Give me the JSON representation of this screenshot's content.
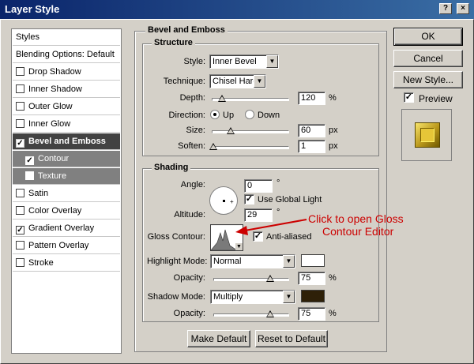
{
  "window": {
    "title": "Layer Style",
    "help_glyph": "?",
    "close_glyph": "×"
  },
  "styles_list": {
    "header": "Styles",
    "blending": "Blending Options: Default",
    "items": [
      {
        "label": "Drop Shadow",
        "checked": false
      },
      {
        "label": "Inner Shadow",
        "checked": false
      },
      {
        "label": "Outer Glow",
        "checked": false
      },
      {
        "label": "Inner Glow",
        "checked": false
      },
      {
        "label": "Bevel and Emboss",
        "checked": true,
        "selected": true
      },
      {
        "label": "Contour",
        "checked": true,
        "sub": true
      },
      {
        "label": "Texture",
        "checked": false,
        "sub": true
      },
      {
        "label": "Satin",
        "checked": false
      },
      {
        "label": "Color Overlay",
        "checked": false
      },
      {
        "label": "Gradient Overlay",
        "checked": true
      },
      {
        "label": "Pattern Overlay",
        "checked": false
      },
      {
        "label": "Stroke",
        "checked": false
      }
    ],
    "check_glyph": "✓"
  },
  "bevel": {
    "section_title": "Bevel and Emboss",
    "structure_title": "Structure",
    "style_label": "Style:",
    "style_value": "Inner Bevel",
    "technique_label": "Technique:",
    "technique_value": "Chisel Hard",
    "depth_label": "Depth:",
    "depth_value": "120",
    "depth_unit": "%",
    "depth_slider_fraction": 0.12,
    "direction_label": "Direction:",
    "direction_up": "Up",
    "direction_down": "Down",
    "size_label": "Size:",
    "size_value": "60",
    "size_unit": "px",
    "size_slider_fraction": 0.24,
    "soften_label": "Soften:",
    "soften_value": "1",
    "soften_unit": "px",
    "soften_slider_fraction": 0.01
  },
  "shading": {
    "title": "Shading",
    "angle_label": "Angle:",
    "angle_value": "0",
    "angle_unit": "°",
    "global_light_label": "Use Global Light",
    "altitude_label": "Altitude:",
    "altitude_value": "29",
    "altitude_unit": "°",
    "gloss_label": "Gloss Contour:",
    "antialiased_label": "Anti-aliased",
    "highlight_label": "Highlight Mode:",
    "highlight_value": "Normal",
    "highlight_color": "#ffffff",
    "highlight_opacity_label": "Opacity:",
    "highlight_opacity": "75",
    "highlight_opacity_fraction": 0.75,
    "opacity_unit": "%",
    "shadow_label": "Shadow Mode:",
    "shadow_value": "Multiply",
    "shadow_color": "#2e2008",
    "shadow_opacity_label": "Opacity:",
    "shadow_opacity": "75",
    "shadow_opacity_fraction": 0.75
  },
  "buttons": {
    "ok": "OK",
    "cancel": "Cancel",
    "new_style": "New Style...",
    "preview": "Preview",
    "make_default": "Make Default",
    "reset_default": "Reset to Default"
  },
  "annotation": {
    "line1": "Click to open Gloss",
    "line2": "Contour Editor",
    "color": "#cc0000"
  }
}
